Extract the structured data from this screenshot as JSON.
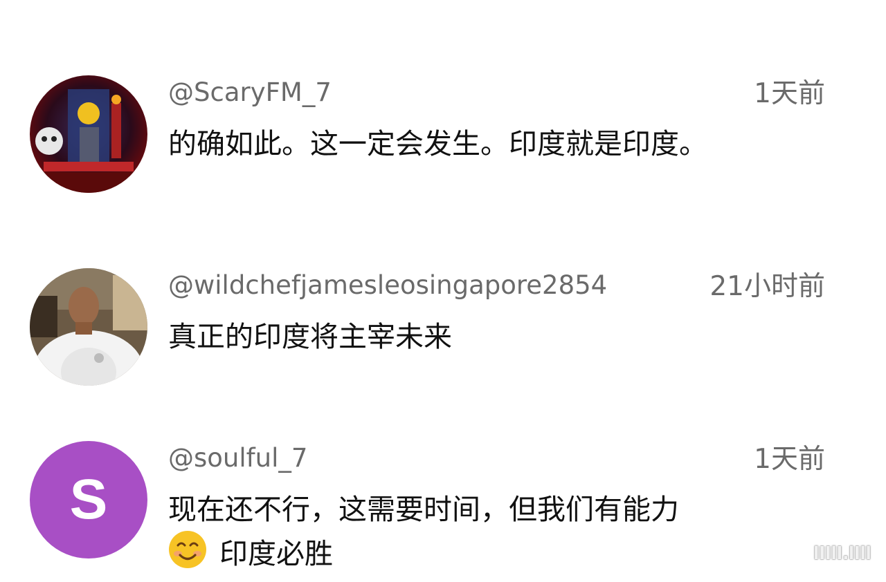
{
  "comments": [
    {
      "handle": "@ScaryFM_7",
      "time": "1天前",
      "text": "的确如此。这一定会发生。印度就是印度。"
    },
    {
      "handle": "@wildchefjamesleosingapore2854",
      "time": "21小时前",
      "text": "真正的印度将主宰未来"
    },
    {
      "handle": "@soulful_7",
      "time": "1天前",
      "avatar_letter": "S",
      "text_line1": "现在还不行，这需要时间，但我们有能力",
      "text_line2": "印度必胜",
      "emoji_icon": "smiling-face-emoji",
      "avatar_color": "#a84fc5"
    }
  ],
  "watermark": "lIIlI.lIll"
}
